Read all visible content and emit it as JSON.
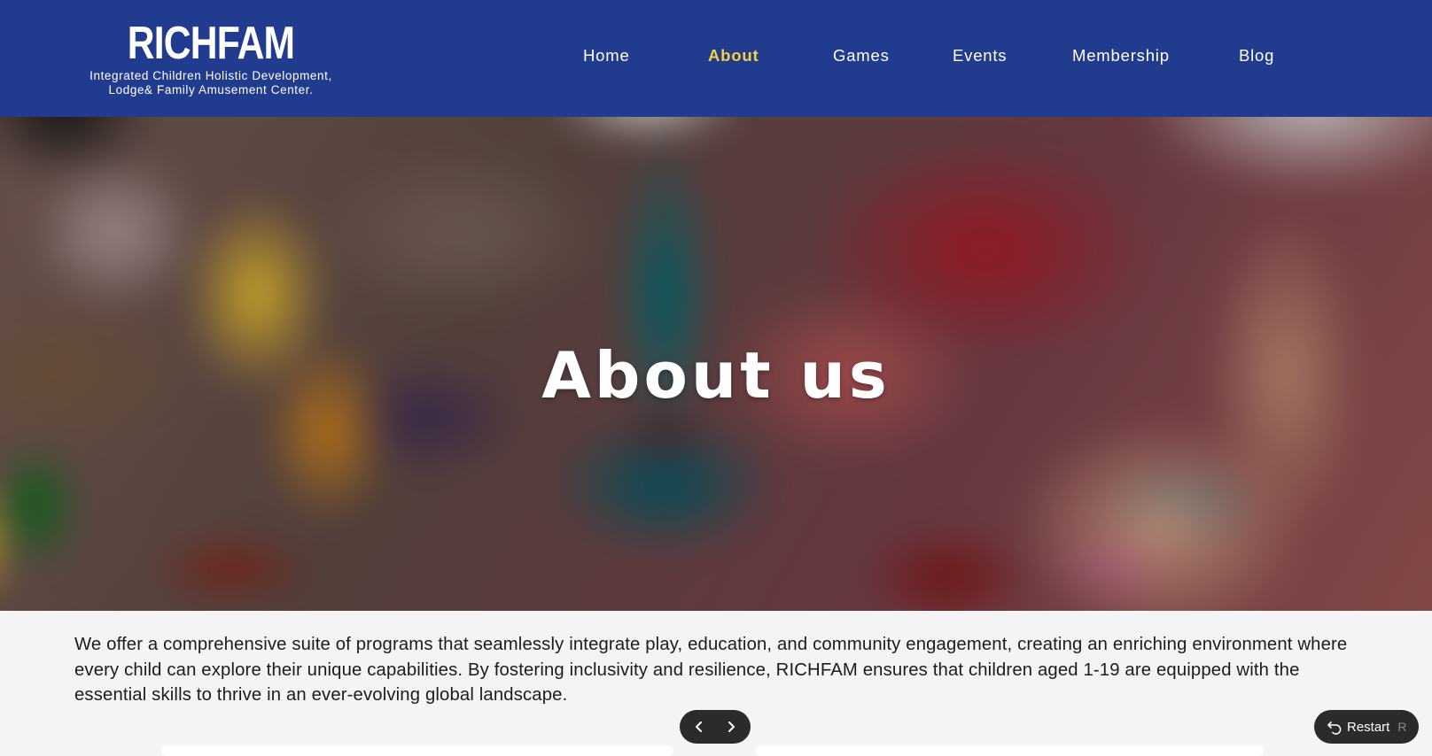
{
  "header": {
    "brand": "RICHFAM",
    "tagline_line1": "Integrated Children Holistic Development,",
    "tagline_line2": "Lodge& Family Amusement Center."
  },
  "nav": {
    "active": "About",
    "items": [
      {
        "label": "Home"
      },
      {
        "label": "About"
      },
      {
        "label": "Games"
      },
      {
        "label": "Events"
      },
      {
        "label": "Membership"
      },
      {
        "label": "Blog"
      }
    ]
  },
  "hero": {
    "title": "About us",
    "image_description_icon": "children-painting-photo"
  },
  "intro": {
    "text": "We offer a comprehensive suite of programs that seamlessly integrate play, education, and community engagement, creating an enriching environment where every child can explore their unique capabilities. By fostering inclusivity and resilience, RICHFAM ensures that children aged 1-19 are equipped with the essential skills to thrive in an ever-evolving global landscape."
  },
  "controls": {
    "prev_icon": "chevron-left-icon",
    "next_icon": "chevron-right-icon",
    "restart_label": "Restart",
    "restart_shortcut": "R",
    "restart_icon": "undo-icon"
  },
  "colors": {
    "header_bg": "#213c8f",
    "nav_active": "#f3cf44",
    "page_bg": "#f4f4f4",
    "control_bg": "#2b2b2b"
  }
}
